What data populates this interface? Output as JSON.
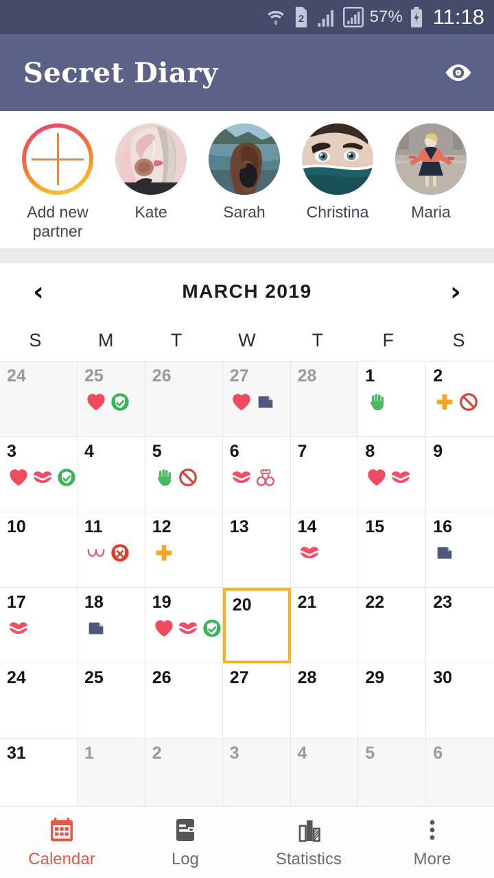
{
  "status_bar": {
    "wifi_icon": "wifi-icon",
    "sim_icon": "sim-2-icon",
    "signal1_icon": "signal-bars-icon",
    "signal2_icon": "signal-bars-boxed-icon",
    "battery_percent": "57%",
    "battery_icon": "battery-charging-icon",
    "clock": "11:18"
  },
  "app_bar": {
    "title": "Secret Diary",
    "eye_icon": "eye-icon",
    "background": "#5a6387"
  },
  "partners": {
    "add_new": {
      "label": "Add new partner",
      "icon": "plus-icon"
    },
    "items": [
      {
        "name": "Kate",
        "avatar": "photo-blonde-woman"
      },
      {
        "name": "Sarah",
        "avatar": "photo-woman-beach"
      },
      {
        "name": "Christina",
        "avatar": "photo-woman-eyes-scarf"
      },
      {
        "name": "Maria",
        "avatar": "photo-woman-red-jacket"
      }
    ]
  },
  "calendar": {
    "prev_icon": "chevron-left-icon",
    "next_icon": "chevron-right-icon",
    "month_label": "MARCH 2019",
    "day_headers": [
      "S",
      "M",
      "T",
      "W",
      "T",
      "F",
      "S"
    ],
    "selected_day": 20,
    "selection_color": "#f5b323",
    "icon_colors": {
      "heart": "#ee4b5e",
      "lips": "#ef4e64",
      "condom": "#34b558",
      "no_condom": "#d9402c",
      "hand": "#46b961",
      "note": "#4f5878",
      "pill": "#f5a623",
      "forbidden": "#d2453a",
      "handcuffs": "#e05a6b",
      "breasts": "#e05a6b"
    },
    "days": [
      {
        "num": "24",
        "other": true,
        "icons": []
      },
      {
        "num": "25",
        "other": true,
        "icons": [
          "heart",
          "condom"
        ]
      },
      {
        "num": "26",
        "other": true,
        "icons": []
      },
      {
        "num": "27",
        "other": true,
        "icons": [
          "heart",
          "note"
        ]
      },
      {
        "num": "28",
        "other": true,
        "icons": []
      },
      {
        "num": "1",
        "other": false,
        "icons": [
          "hand"
        ]
      },
      {
        "num": "2",
        "other": false,
        "icons": [
          "pill",
          "forbidden"
        ]
      },
      {
        "num": "3",
        "other": false,
        "icons": [
          "heart",
          "lips",
          "condom"
        ]
      },
      {
        "num": "4",
        "other": false,
        "icons": []
      },
      {
        "num": "5",
        "other": false,
        "icons": [
          "hand",
          "forbidden"
        ]
      },
      {
        "num": "6",
        "other": false,
        "icons": [
          "lips",
          "handcuffs"
        ]
      },
      {
        "num": "7",
        "other": false,
        "icons": []
      },
      {
        "num": "8",
        "other": false,
        "icons": [
          "heart",
          "lips"
        ]
      },
      {
        "num": "9",
        "other": false,
        "icons": []
      },
      {
        "num": "10",
        "other": false,
        "icons": []
      },
      {
        "num": "11",
        "other": false,
        "icons": [
          "breasts",
          "no_condom"
        ]
      },
      {
        "num": "12",
        "other": false,
        "icons": [
          "pill"
        ]
      },
      {
        "num": "13",
        "other": false,
        "icons": []
      },
      {
        "num": "14",
        "other": false,
        "icons": [
          "lips"
        ]
      },
      {
        "num": "15",
        "other": false,
        "icons": []
      },
      {
        "num": "16",
        "other": false,
        "icons": [
          "note"
        ]
      },
      {
        "num": "17",
        "other": false,
        "icons": [
          "lips"
        ]
      },
      {
        "num": "18",
        "other": false,
        "icons": [
          "note"
        ]
      },
      {
        "num": "19",
        "other": false,
        "icons": [
          "heart",
          "lips",
          "condom"
        ]
      },
      {
        "num": "20",
        "other": false,
        "icons": [],
        "selected": true
      },
      {
        "num": "21",
        "other": false,
        "icons": []
      },
      {
        "num": "22",
        "other": false,
        "icons": []
      },
      {
        "num": "23",
        "other": false,
        "icons": []
      },
      {
        "num": "24",
        "other": false,
        "icons": []
      },
      {
        "num": "25",
        "other": false,
        "icons": []
      },
      {
        "num": "26",
        "other": false,
        "icons": []
      },
      {
        "num": "27",
        "other": false,
        "icons": []
      },
      {
        "num": "28",
        "other": false,
        "icons": []
      },
      {
        "num": "29",
        "other": false,
        "icons": []
      },
      {
        "num": "30",
        "other": false,
        "icons": []
      },
      {
        "num": "31",
        "other": false,
        "icons": []
      },
      {
        "num": "1",
        "other": true,
        "icons": []
      },
      {
        "num": "2",
        "other": true,
        "icons": []
      },
      {
        "num": "3",
        "other": true,
        "icons": []
      },
      {
        "num": "4",
        "other": true,
        "icons": []
      },
      {
        "num": "5",
        "other": true,
        "icons": []
      },
      {
        "num": "6",
        "other": true,
        "icons": []
      }
    ]
  },
  "bottom_nav": {
    "active": "Calendar",
    "active_color": "#e05a4a",
    "items": [
      {
        "label": "Calendar",
        "icon": "calendar-icon",
        "active": true
      },
      {
        "label": "Log",
        "icon": "log-icon",
        "active": false
      },
      {
        "label": "Statistics",
        "icon": "statistics-icon",
        "active": false
      },
      {
        "label": "More",
        "icon": "more-dots-icon",
        "active": false
      }
    ]
  }
}
